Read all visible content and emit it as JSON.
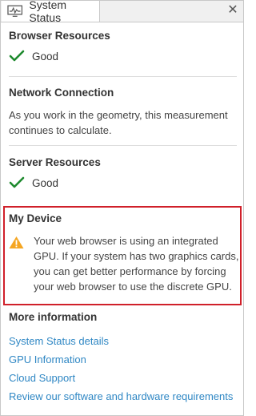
{
  "tab": {
    "label": "System Status",
    "icon": "system-status-monitor-icon"
  },
  "close_icon": "close-icon",
  "sections": {
    "browser": {
      "title": "Browser Resources",
      "status": "Good",
      "icon": "check-icon"
    },
    "network": {
      "title": "Network Connection",
      "text": "As you work in the geometry, this measurement continues to calculate."
    },
    "server": {
      "title": "Server Resources",
      "status": "Good",
      "icon": "check-icon"
    },
    "device": {
      "title": "My Device",
      "icon": "warning-icon",
      "text": "Your web browser is using an integrated GPU. If your system has two graphics cards, you can get better performance by forcing your web browser to use the discrete GPU."
    }
  },
  "more_info": {
    "title": "More information",
    "links": [
      "System Status details",
      "GPU Information",
      "Cloud Support",
      "Review our software and hardware requirements"
    ]
  },
  "colors": {
    "check": "#1e8a2e",
    "warning": "#f5a623",
    "link": "#2f87c4",
    "highlight_border": "#d0202a"
  }
}
